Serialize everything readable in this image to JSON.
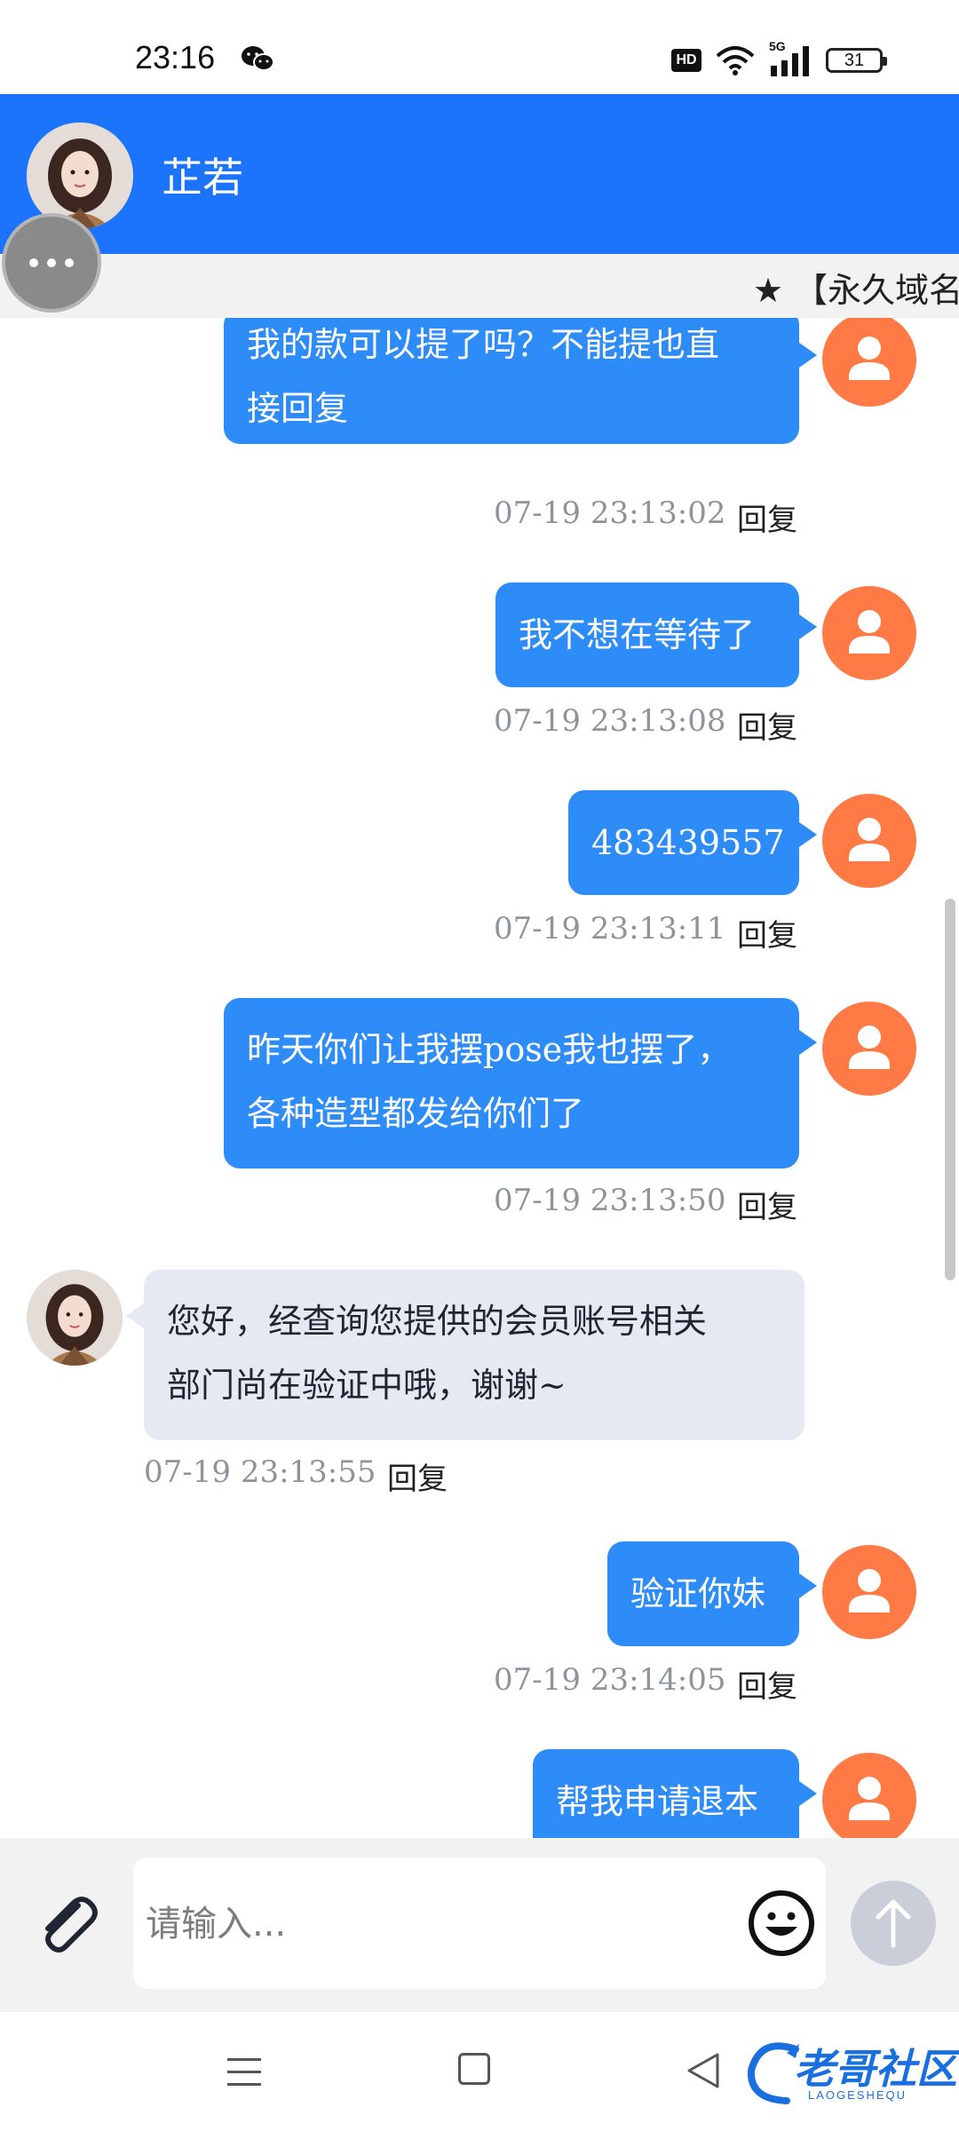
{
  "status_bar": {
    "time": "23:16",
    "hd": "HD",
    "network": "5G",
    "battery": "31"
  },
  "header": {
    "contact_name": "芷若"
  },
  "marquee": {
    "text": "★ 【永久域名"
  },
  "messages": [
    {
      "dir": "out",
      "lines": [
        "我的款可以提了吗？不能提也直",
        "接回复"
      ],
      "time": "07-19 23:13:02",
      "reply": "回复"
    },
    {
      "dir": "out",
      "lines": [
        "我不想在等待了"
      ],
      "time": "07-19 23:13:08",
      "reply": "回复"
    },
    {
      "dir": "out",
      "lines": [
        "483439557"
      ],
      "time": "07-19 23:13:11",
      "reply": "回复"
    },
    {
      "dir": "out",
      "lines": [
        "昨天你们让我摆pose我也摆了，",
        "各种造型都发给你们了"
      ],
      "time": "07-19 23:13:50",
      "reply": "回复"
    },
    {
      "dir": "in",
      "lines": [
        "您好，经查询您提供的会员账号相关",
        "部门尚在验证中哦，谢谢~"
      ],
      "time": "07-19 23:13:55",
      "reply": "回复"
    },
    {
      "dir": "out",
      "lines": [
        "验证你妹"
      ],
      "time": "07-19 23:14:05",
      "reply": "回复"
    },
    {
      "dir": "out",
      "lines": [
        "帮我申请退本"
      ]
    }
  ],
  "input": {
    "placeholder": "请输入..."
  },
  "watermark": {
    "text": "老哥社区",
    "sub": "LAOGESHEQU"
  },
  "colors": {
    "header": "#1b74fb",
    "out_bubble": "#2d8cf8",
    "in_bubble": "#e5e9f1",
    "user_avatar": "#ff7a45"
  }
}
